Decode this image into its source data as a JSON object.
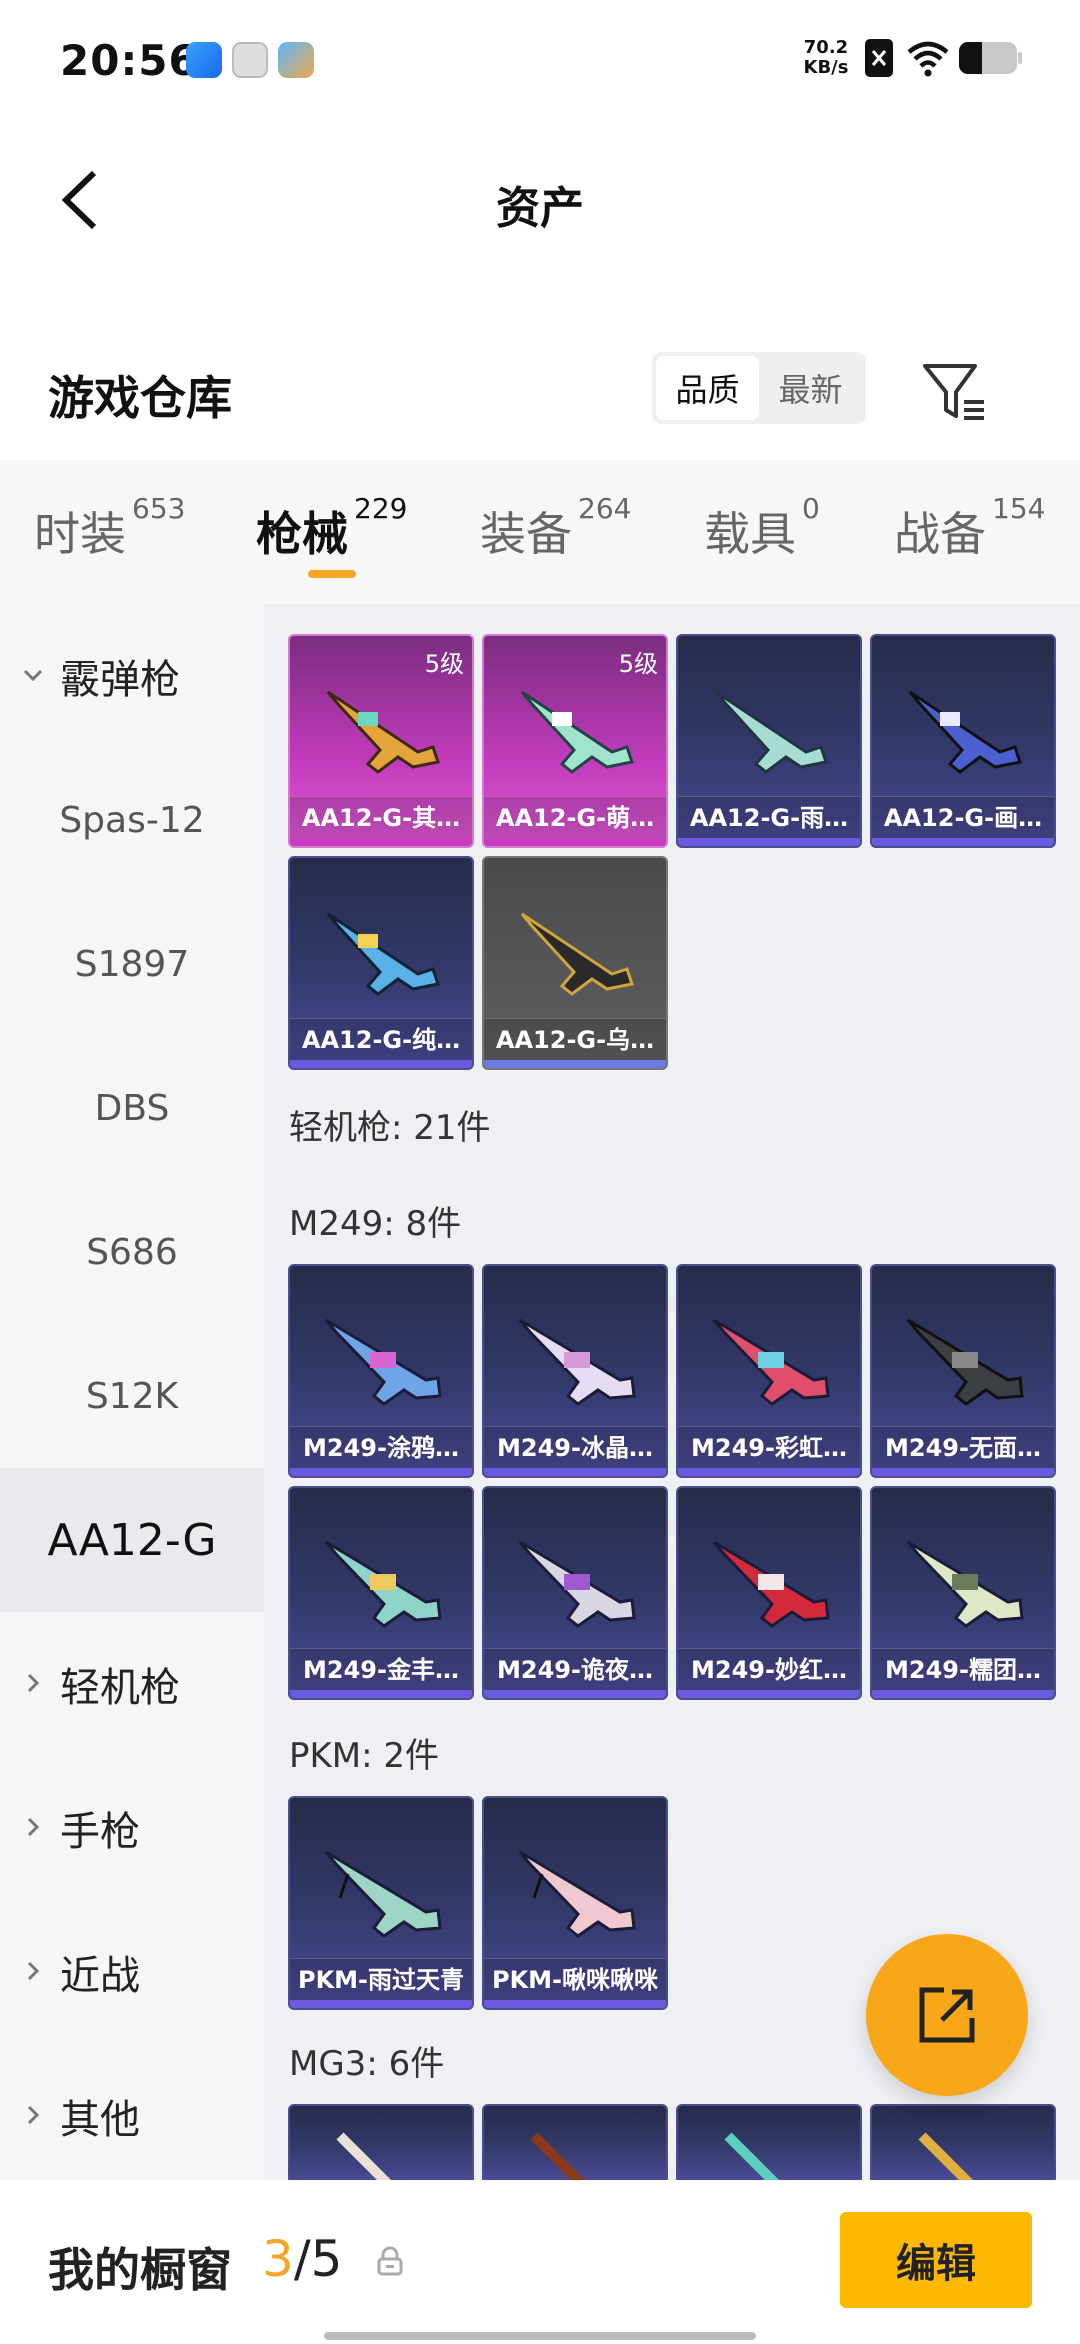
{
  "status_bar": {
    "time": "20:56",
    "net_speed_value": "70.2",
    "net_speed_unit": "KB/s"
  },
  "nav": {
    "title": "资产"
  },
  "header": {
    "title": "游戏仓库",
    "sort_options": [
      "品质",
      "最新"
    ],
    "active_sort": "品质"
  },
  "tabs": [
    {
      "label": "时装",
      "count": "653"
    },
    {
      "label": "枪械",
      "count": "229"
    },
    {
      "label": "装备",
      "count": "264"
    },
    {
      "label": "载具",
      "count": "0"
    },
    {
      "label": "战备",
      "count": "154"
    }
  ],
  "active_tab": "枪械",
  "sidebar": {
    "group_shotgun": "霰弹枪",
    "items": [
      "Spas-12",
      "S1897",
      "DBS",
      "S686",
      "S12K",
      "AA12-G"
    ],
    "active_item": "AA12-G",
    "groups": [
      "轻机枪",
      "手枪",
      "近战",
      "其他"
    ]
  },
  "content": {
    "aa12_items": [
      {
        "name": "AA12-G-其…",
        "level": "5级",
        "style": "pink"
      },
      {
        "name": "AA12-G-萌…",
        "level": "5级",
        "style": "pink"
      },
      {
        "name": "AA12-G-雨…",
        "style": "blue"
      },
      {
        "name": "AA12-G-画…",
        "style": "blue"
      },
      {
        "name": "AA12-G-纯…",
        "style": "blue"
      },
      {
        "name": "AA12-G-乌…",
        "style": "grey"
      }
    ],
    "lmg_heading": "轻机枪: 21件",
    "m249_heading": "M249: 8件",
    "m249_items": [
      "M249-涂鸦…",
      "M249-冰晶…",
      "M249-彩虹…",
      "M249-无面…",
      "M249-金丰…",
      "M249-诡夜…",
      "M249-妙红…",
      "M249-糯团…"
    ],
    "pkm_heading": "PKM: 2件",
    "pkm_items": [
      "PKM-雨过天青",
      "PKM-啾咪啾咪"
    ],
    "mg3_heading": "MG3: 6件"
  },
  "bottom": {
    "title": "我的橱窗",
    "current": "3",
    "sep_total": "/5",
    "edit_label": "编辑"
  },
  "colors": {
    "accent": "#f5a623",
    "edit_button": "#ffb800",
    "fab": "#f7a717"
  }
}
